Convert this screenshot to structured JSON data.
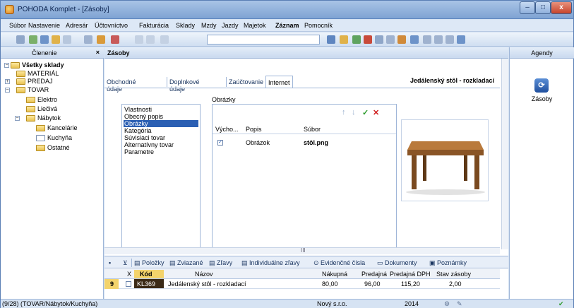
{
  "window": {
    "title": "POHODA Komplet - [Zásoby]",
    "controls": [
      "–",
      "□",
      "x"
    ]
  },
  "menu": {
    "items": [
      "Súbor",
      "Nastavenie",
      "Adresár",
      "Účtovníctvo",
      "Fakturácia",
      "Sklady",
      "Mzdy",
      "Jazdy",
      "Majetok",
      "Záznam",
      "Pomocník"
    ]
  },
  "left_pane": {
    "title": "Členenie",
    "close": "×",
    "tree": [
      {
        "label": "Všetky sklady",
        "level": 0,
        "bold": true,
        "toggle": "−"
      },
      {
        "label": "MATERIÁL",
        "level": 1,
        "toggle": ""
      },
      {
        "label": "PREDAJ",
        "level": 1,
        "toggle": "+"
      },
      {
        "label": "TOVAR",
        "level": 1,
        "toggle": "−"
      },
      {
        "label": "Elektro",
        "level": 2,
        "toggle": ""
      },
      {
        "label": "Liečivá",
        "level": 2,
        "toggle": ""
      },
      {
        "label": "Nábytok",
        "level": 2,
        "toggle": "−"
      },
      {
        "label": "Kancelárie",
        "level": 3,
        "toggle": ""
      },
      {
        "label": "Kuchyňa",
        "level": 3,
        "toggle": "",
        "selected": true
      },
      {
        "label": "Ostatné",
        "level": 3,
        "toggle": ""
      }
    ]
  },
  "content": {
    "title": "Zásoby",
    "tabs": [
      "Obchodné údaje",
      "Doplnkové údaje",
      "Zaúčtovanie",
      "Internet"
    ],
    "active_tab": "Internet",
    "record_title": "Jedálenský stôl - rozkladací",
    "section_label": "Obrázky",
    "categories": [
      "Vlastnosti",
      "Obecný popis",
      "Obrázky",
      "Kategória",
      "Súvisiaci tovar",
      "Alternatívny tovar",
      "Parametre"
    ],
    "selected_category": "Obrázky",
    "grid": {
      "icons": [
        "up-arrow-icon",
        "down-arrow-icon",
        "check-icon",
        "delete-icon"
      ],
      "headers": [
        "Výcho...",
        "Popis",
        "Súbor"
      ],
      "rows": [
        {
          "default": true,
          "popis": "Obrázok",
          "subor": "stôl.png"
        }
      ]
    },
    "image_alt": "table-image",
    "hscroll_label": "III",
    "bottom_tabs": [
      "Položky",
      "Zviazané",
      "Zľavy",
      "Individuálne zľavy",
      "Evidenčné čísla",
      "Dokumenty",
      "Poznámky"
    ],
    "table": {
      "headers": [
        "X",
        "Kód",
        "Názov",
        "Nákupná",
        "Predajná",
        "Predajná DPH",
        "Stav zásoby"
      ],
      "rows": [
        {
          "row_no": "9",
          "kod": "KL369",
          "nazov": "Jedálenský stôl - rozkladací",
          "nakupna": "80,00",
          "predajna": "96,00",
          "predajna_dph": "115,20",
          "stav": "2,00"
        }
      ]
    }
  },
  "right_pane": {
    "title": "Agendy",
    "item_label": "Zásoby"
  },
  "status": {
    "path": "(9/28) (TOVAR/Nábytok/Kuchyňa)",
    "company": "Nový s.r.o.",
    "year": "2014"
  },
  "colors": {
    "accent": "#2b5fb3",
    "code_cell_bg": "#3b2a16",
    "code_header_bg": "#f3d36b",
    "row_no_bg": "#f3d36b",
    "delete": "#d02020",
    "confirm": "#2a9a2a"
  }
}
